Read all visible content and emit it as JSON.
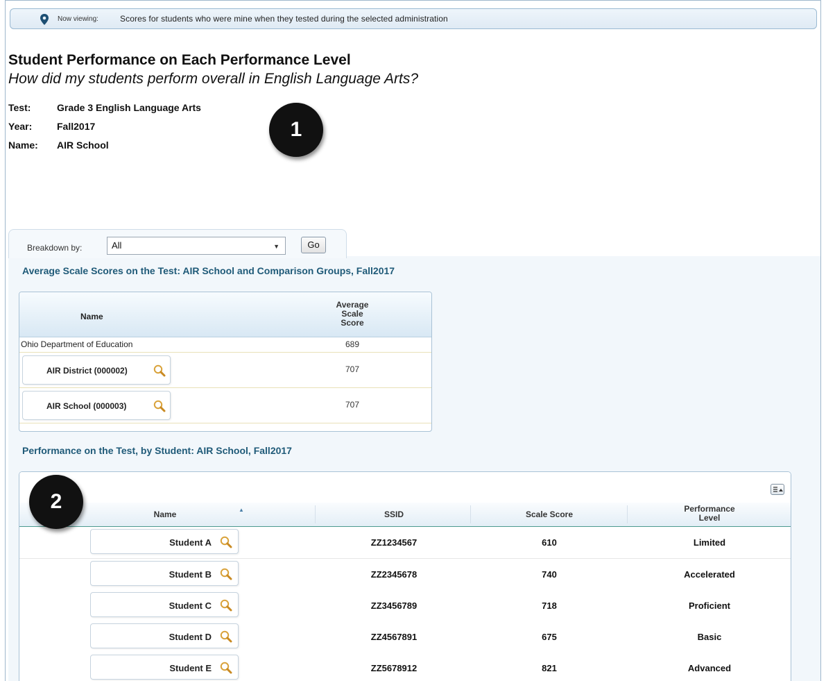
{
  "viewing": {
    "prefix": "Now viewing:",
    "text": "Scores for students who were mine when they tested during the selected administration"
  },
  "header": {
    "title": "Student Performance on Each Performance Level",
    "subtitle": "How did my students perform overall in English Language Arts?"
  },
  "meta": {
    "test_label": "Test:",
    "test_value": "Grade 3 English Language Arts",
    "year_label": "Year:",
    "year_value": "Fall2017",
    "name_label": "Name:",
    "name_value": "AIR School"
  },
  "callouts": [
    "1",
    "2"
  ],
  "breakdown": {
    "label": "Breakdown by:",
    "selected": "All",
    "go_label": "Go"
  },
  "avg_section": {
    "title": "Average Scale Scores on the Test: AIR School and Comparison Groups, Fall2017",
    "col_name": "Name",
    "col_score_lines": [
      "Average",
      "Scale",
      "Score"
    ],
    "rows": [
      {
        "name": "Ohio Department of Education",
        "score": "689"
      },
      {
        "name": "AIR District (000002)",
        "score": "707"
      },
      {
        "name": "AIR School (000003)",
        "score": "707"
      }
    ]
  },
  "student_section": {
    "title": "Performance on the Test, by Student: AIR School, Fall2017",
    "columns": [
      "Name",
      "SSID",
      "Scale Score",
      "Performance Level"
    ],
    "perf_level_lines": [
      "Performance",
      "Level"
    ],
    "rows": [
      {
        "name": "Student A",
        "ssid": "ZZ1234567",
        "score": "610",
        "level": "Limited"
      },
      {
        "name": "Student B",
        "ssid": "ZZ2345678",
        "score": "740",
        "level": "Accelerated"
      },
      {
        "name": "Student C",
        "ssid": "ZZ3456789",
        "score": "718",
        "level": "Proficient"
      },
      {
        "name": "Student D",
        "ssid": "ZZ4567891",
        "score": "675",
        "level": "Basic"
      },
      {
        "name": "Student E",
        "ssid": "ZZ5678912",
        "score": "821",
        "level": "Advanced"
      }
    ]
  },
  "colors": {
    "section_title": "#1f5a78",
    "header_accent": "#4c9a8e",
    "magnifier": "#d9a23a"
  }
}
